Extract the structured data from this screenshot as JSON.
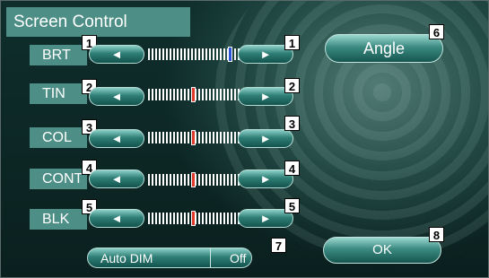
{
  "window": {
    "title": "Screen Control"
  },
  "rows": [
    {
      "label": "BRT",
      "badge": "1",
      "left_arrow": "◄",
      "right_arrow": "►",
      "level": 0.9,
      "thumb_color": "#2a55d8"
    },
    {
      "label": "TIN",
      "badge": "2",
      "left_arrow": "◄",
      "right_arrow": "►",
      "level": 0.48,
      "thumb_color": "#e23a2a"
    },
    {
      "label": "COL",
      "badge": "3",
      "left_arrow": "◄",
      "right_arrow": "►",
      "level": 0.48,
      "thumb_color": "#e23a2a"
    },
    {
      "label": "CONT",
      "badge": "4",
      "left_arrow": "◄",
      "right_arrow": "►",
      "level": 0.48,
      "thumb_color": "#e23a2a"
    },
    {
      "label": "BLK",
      "badge": "5",
      "left_arrow": "◄",
      "right_arrow": "►",
      "level": 0.48,
      "thumb_color": "#e23a2a"
    }
  ],
  "angle_button": {
    "label": "Angle",
    "badge": "6"
  },
  "auto_dim": {
    "label": "Auto DIM",
    "value": "Off",
    "badge": "7"
  },
  "ok_button": {
    "label": "OK",
    "badge": "8"
  },
  "colors": {
    "accent": "#4d8f86",
    "background": "#0d2a28"
  }
}
